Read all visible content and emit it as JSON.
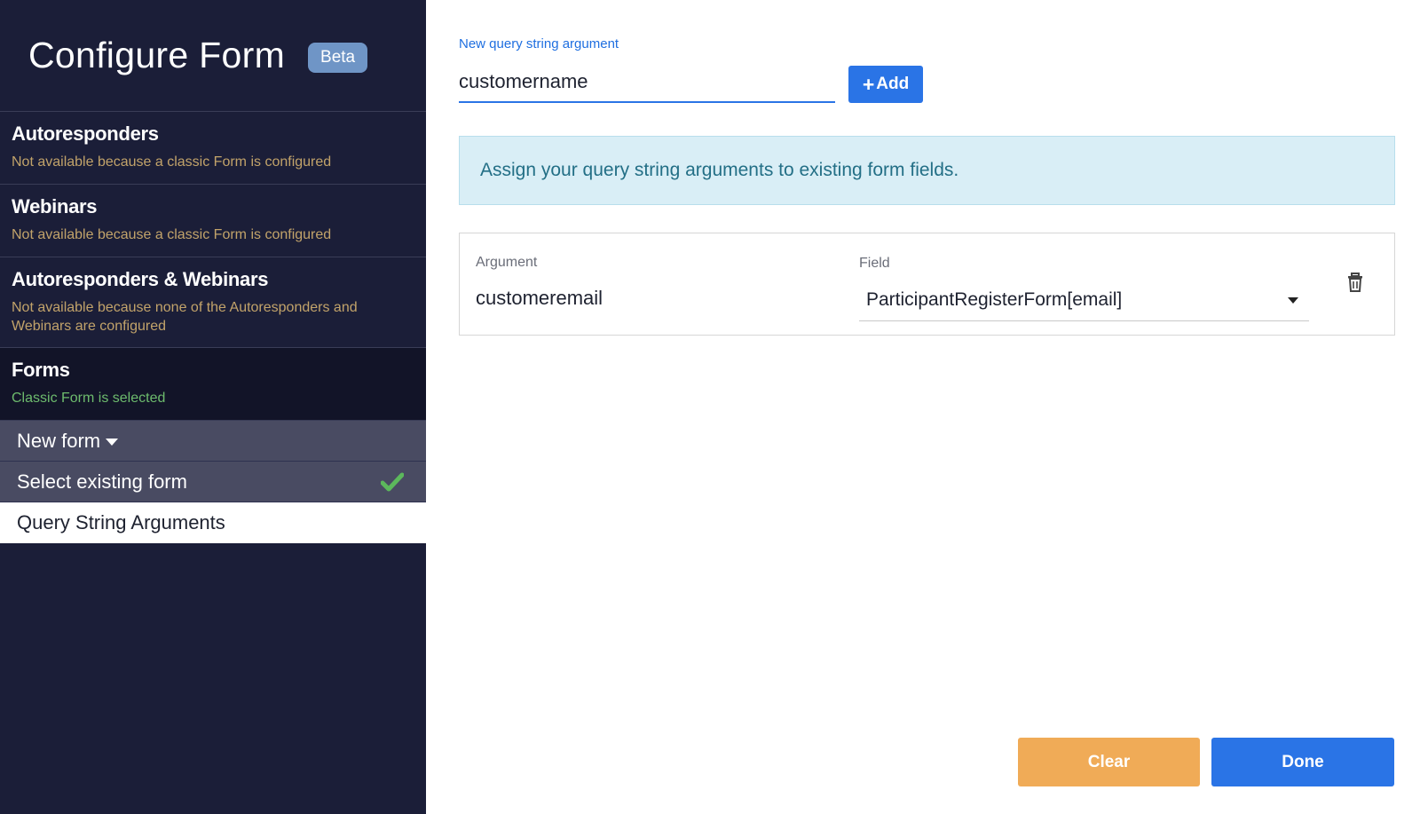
{
  "sidebar": {
    "title": "Configure Form",
    "badge": "Beta",
    "sections": [
      {
        "title": "Autoresponders",
        "subtitle": "Not available because a classic Form is configured"
      },
      {
        "title": "Webinars",
        "subtitle": "Not available because a classic Form is configured"
      },
      {
        "title": "Autoresponders & Webinars",
        "subtitle": "Not available because none of the Autoresponders and Webinars are configured"
      },
      {
        "title": "Forms",
        "subtitle": "Classic Form is selected"
      }
    ],
    "menu": {
      "new_form": "New form",
      "select_existing": "Select existing form",
      "query_string": "Query String Arguments"
    }
  },
  "main": {
    "new_arg_label": "New query string argument",
    "new_arg_value": "customername",
    "add_label": "Add",
    "info_text": "Assign your query string arguments to existing form fields.",
    "mapping": {
      "argument_label": "Argument",
      "argument_value": "customeremail",
      "field_label": "Field",
      "field_value": "ParticipantRegisterForm[email]"
    },
    "clear_label": "Clear",
    "done_label": "Done"
  },
  "colors": {
    "sidebar_bg": "#1b1e38",
    "accent_blue": "#2a74e6",
    "clear_orange": "#f0ab57",
    "success_green": "#5cb85c",
    "disabled_gold": "#c2a36a"
  }
}
